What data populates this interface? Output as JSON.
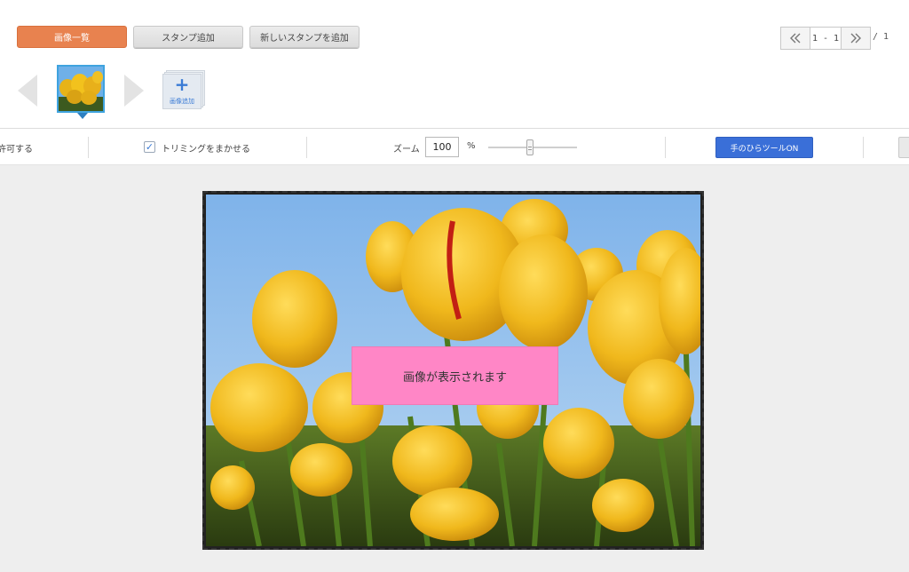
{
  "tabs": {
    "image_list": "画像一覧",
    "add_stamp": "スタンプ追加",
    "add_new_stamp": "新しいスタンプを追加"
  },
  "pager": {
    "range": "1 - 1",
    "total": "/ 1"
  },
  "thumbnails": {
    "add_image_label": "画像追加",
    "add_image_icon": "plus-icon"
  },
  "toolbar": {
    "allow_label": "許可する",
    "trimming_label": "トリミングをまかせる",
    "trimming_checked": true,
    "zoom_label": "ズーム",
    "zoom_value": "100",
    "zoom_unit": "%",
    "zoom_slider_level": 0.45,
    "hand_tool_button": "手のひらツールON"
  },
  "canvas": {
    "overlay_text": "画像が表示されます"
  },
  "colors": {
    "accent_orange": "#e8824f",
    "primary_blue": "#3a6fd8",
    "overlay_pink": "#ff86c6",
    "selection_blue": "#3fa3df"
  }
}
